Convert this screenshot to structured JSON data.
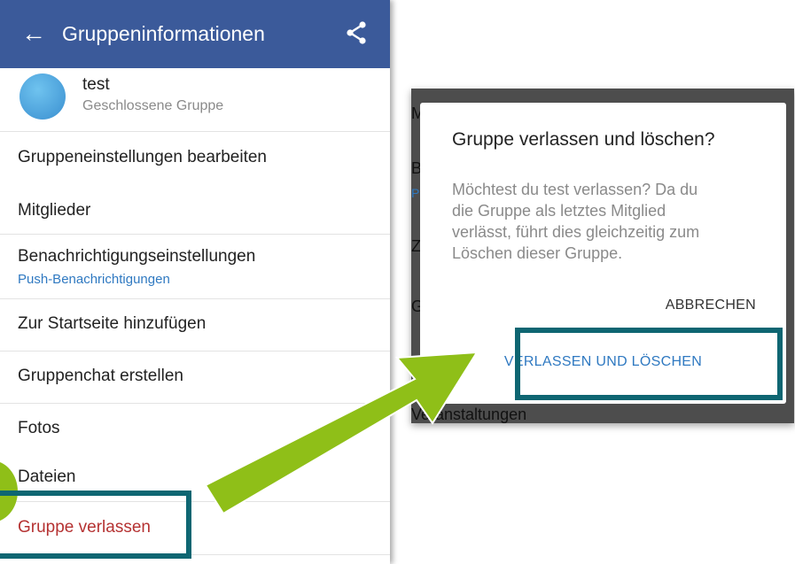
{
  "app_bar": {
    "back_glyph": "←",
    "title": "Gruppeninformationen"
  },
  "group": {
    "name": "test",
    "type": "Geschlossene Gruppe"
  },
  "menu": [
    {
      "label": "Gruppeneinstellungen bearbeiten"
    },
    {
      "label": "Mitglieder"
    },
    {
      "label": "Benachrichtigungseinstellungen",
      "sub": "Push-Benachrichtigungen"
    },
    {
      "label": "Zur Startseite hinzufügen"
    },
    {
      "label": "Gruppenchat erstellen"
    },
    {
      "label": "Fotos"
    },
    {
      "label": "Dateien"
    },
    {
      "label": "Gruppe verlassen"
    }
  ],
  "dialog": {
    "title": "Gruppe verlassen und löschen?",
    "body": "Möchtest du test verlassen? Da du\ndie Gruppe als letztes Mitglied\nverlässt, führt dies gleichzeitig zum\nLöschen dieser Gruppe.",
    "cancel_label": "ABBRECHEN",
    "confirm_label": "VERLASSEN UND LÖSCHEN"
  },
  "background_fragments": {
    "f1": "M",
    "f2": "Be",
    "f3": "Pu",
    "f4": "Zu",
    "f5": "G",
    "f6": "Fo",
    "bottom": "Veranstaltungen"
  },
  "colors": {
    "app_bar": "#3b5a9a",
    "highlight": "#0e6672",
    "arrow": "#8fbf18",
    "leave_text": "#b53232",
    "link_text": "#2f79c1"
  },
  "icons": {
    "back": "arrow-left-icon",
    "share": "share-icon",
    "arrow": "green-arrow"
  }
}
